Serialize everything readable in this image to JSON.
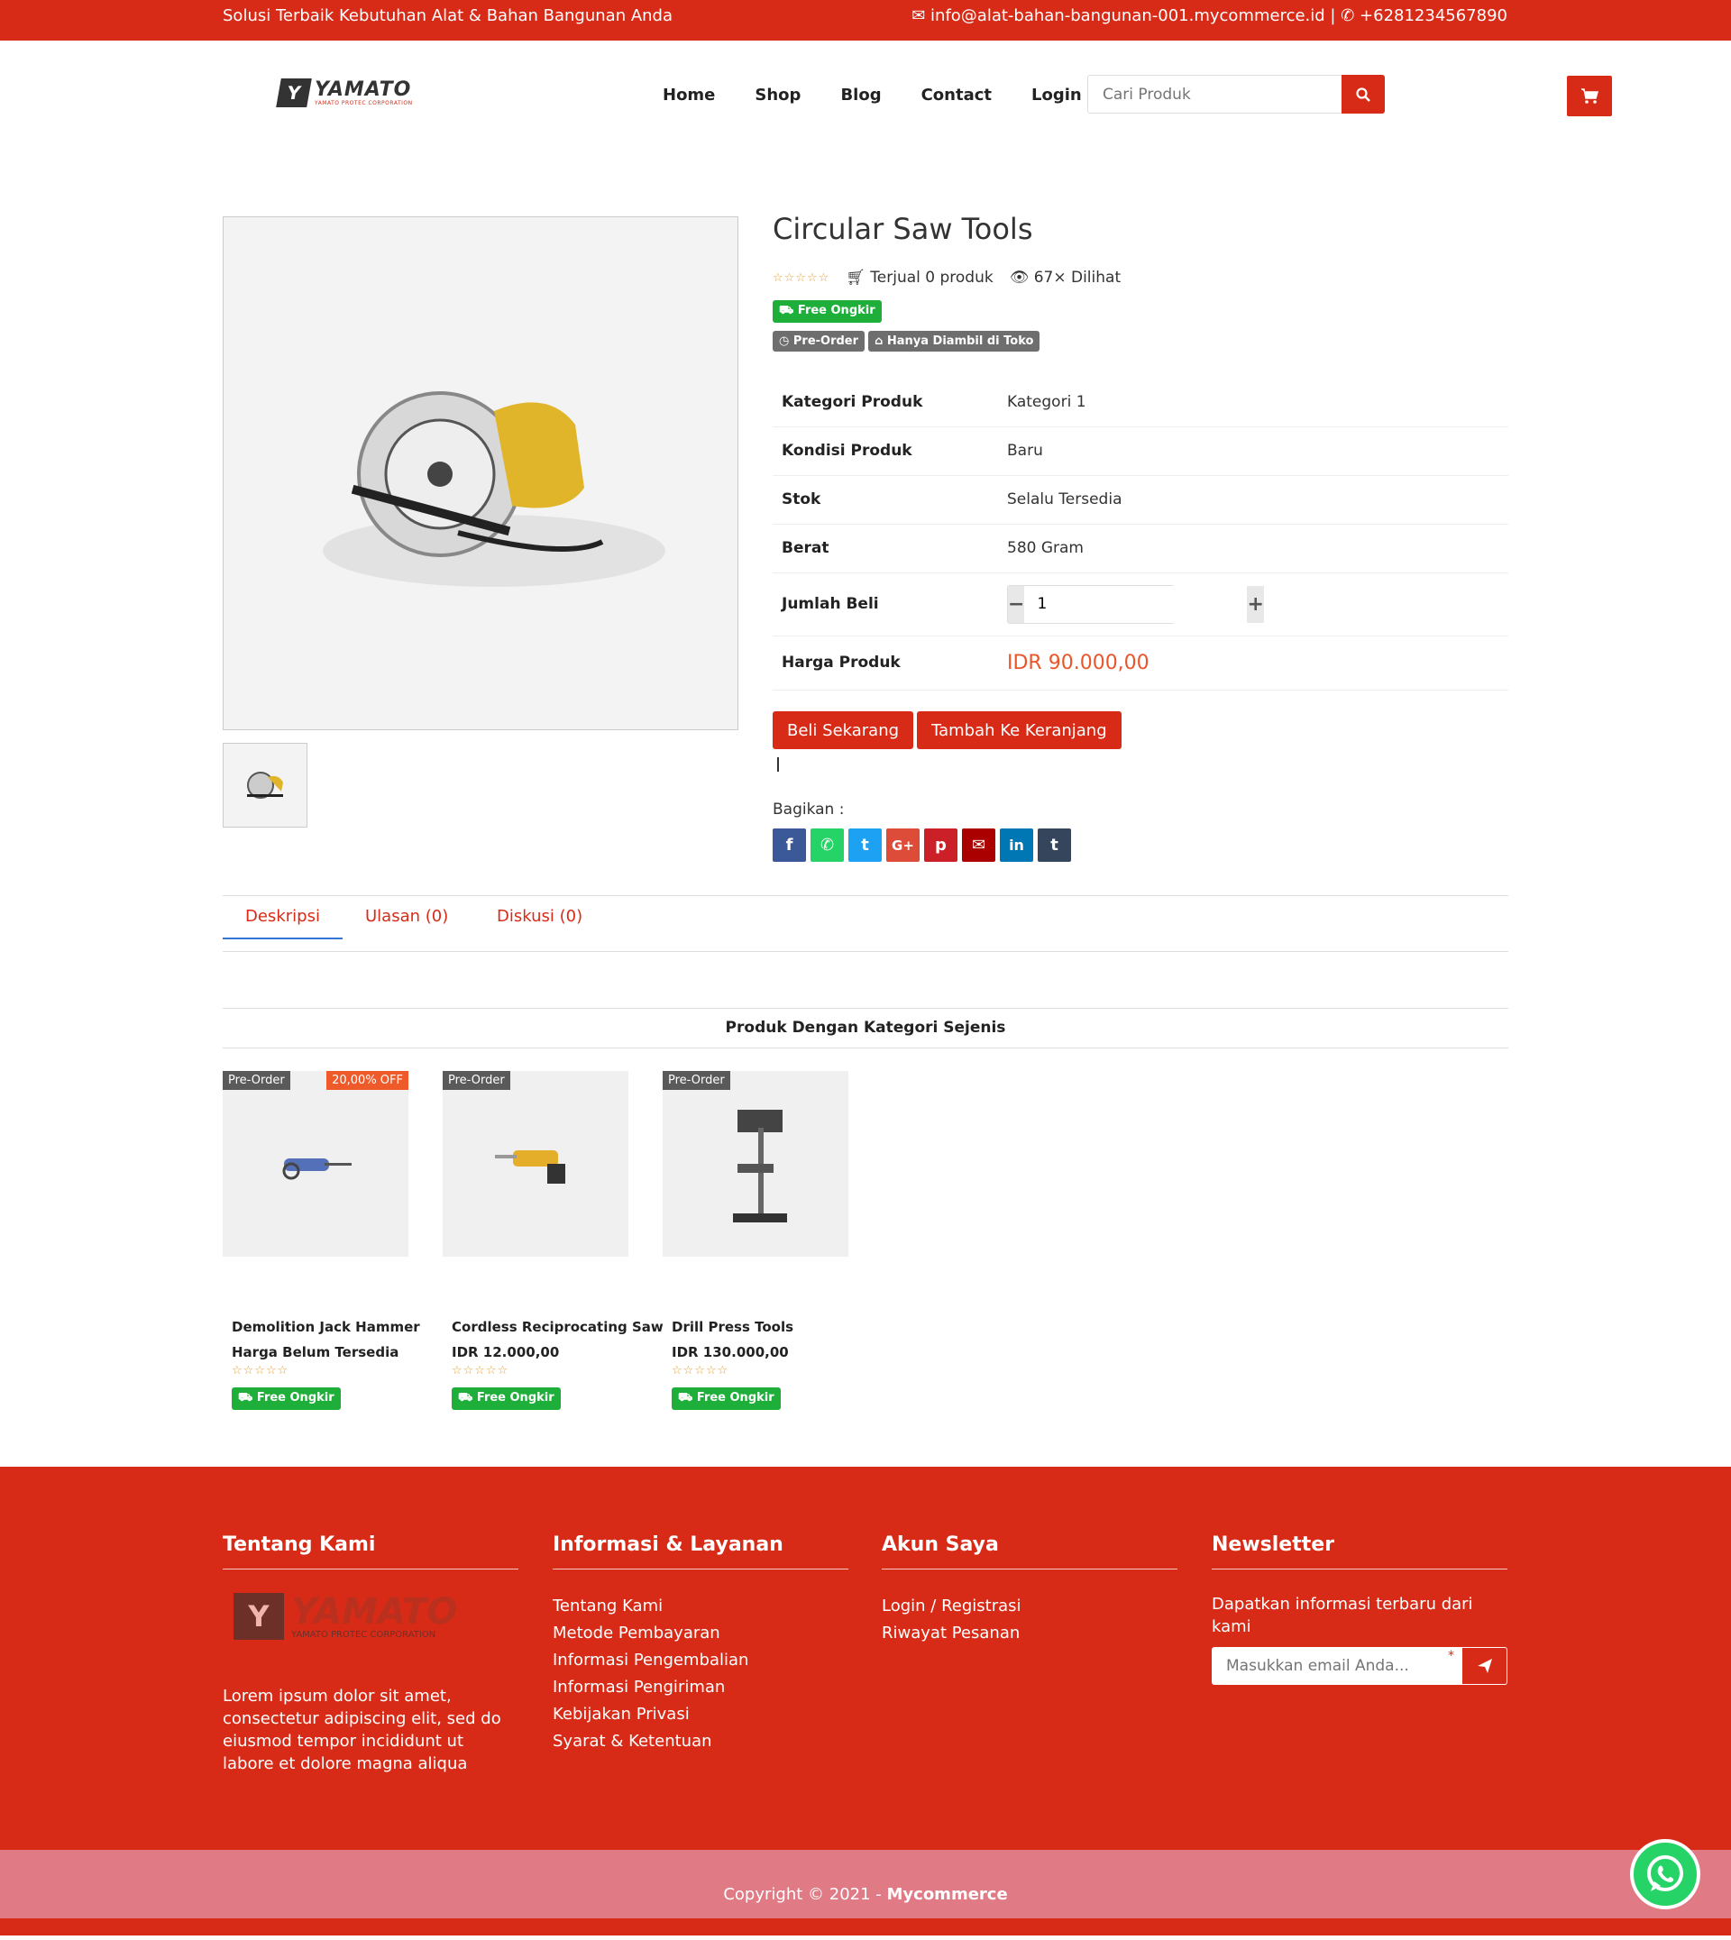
{
  "topbar": {
    "tagline": "Solusi Terbaik Kebutuhan Alat & Bahan Bangunan Anda",
    "email": "info@alat-bahan-bangunan-001.mycommerce.id",
    "phone": "+6281234567890"
  },
  "header": {
    "logo_text": "YAMATO",
    "logo_sub": "YAMATO PROTEC CORPORATION",
    "nav": [
      "Home",
      "Shop",
      "Blog",
      "Contact",
      "Login"
    ],
    "search_placeholder": "Cari Produk"
  },
  "product": {
    "title": "Circular Saw Tools",
    "sold": "Terjual 0 produk",
    "views": "67× Dilihat",
    "badge_free": "Free Ongkir",
    "badge_preorder": "Pre-Order",
    "badge_pickup": "Hanya Diambil di Toko",
    "specs": [
      {
        "label": "Kategori Produk",
        "value": "Kategori 1"
      },
      {
        "label": "Kondisi Produk",
        "value": "Baru"
      },
      {
        "label": "Stok",
        "value": "Selalu Tersedia"
      },
      {
        "label": "Berat",
        "value": "580 Gram"
      }
    ],
    "qty_label": "Jumlah Beli",
    "qty_value": "1",
    "price_label": "Harga Produk",
    "price": "IDR 90.000,00",
    "buy_now": "Beli Sekarang",
    "add_cart": "Tambah Ke Keranjang",
    "share_label": "Bagikan :"
  },
  "tabs": [
    "Deskripsi",
    "Ulasan (0)",
    "Diskusi (0)"
  ],
  "related": {
    "heading": "Produk Dengan Kategori Sejenis",
    "items": [
      {
        "name": "Demolition Jack Hammer",
        "price": "Harga Belum Tersedia",
        "tag": "Pre-Order",
        "discount": "20,00% OFF",
        "free": "Free Ongkir"
      },
      {
        "name": "Cordless Reciprocating Saw",
        "price": "IDR 12.000,00",
        "tag": "Pre-Order",
        "free": "Free Ongkir"
      },
      {
        "name": "Drill Press Tools",
        "price": "IDR 130.000,00",
        "tag": "Pre-Order",
        "free": "Free Ongkir"
      }
    ]
  },
  "footer": {
    "about_title": "Tentang Kami",
    "about_text": "Lorem ipsum dolor sit amet, consectetur adipiscing elit, sed do eiusmod tempor incididunt ut labore et dolore magna aliqua",
    "info_title": "Informasi & Layanan",
    "info_links": [
      "Tentang Kami",
      "Metode Pembayaran",
      "Informasi Pengembalian",
      "Informasi Pengiriman",
      "Kebijakan Privasi",
      "Syarat & Ketentuan"
    ],
    "account_title": "Akun Saya",
    "account_links": [
      "Login / Registrasi",
      "Riwayat Pesanan"
    ],
    "news_title": "Newsletter",
    "news_text": "Dapatkan informasi terbaru dari kami",
    "news_placeholder": "Masukkan email Anda...",
    "copyright": "Copyright © 2021 - ",
    "brand": "Mycommerce"
  },
  "colors": {
    "primary": "#d82b17",
    "price": "#e8562a",
    "green": "#1eae3a"
  }
}
